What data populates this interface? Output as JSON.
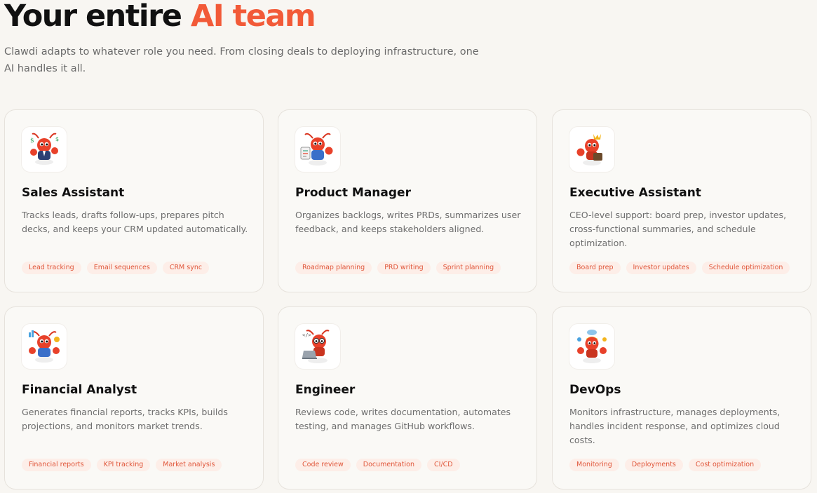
{
  "hero": {
    "title_prefix": "Your entire ",
    "title_accent": "AI team",
    "subtitle": "Clawdi adapts to whatever role you need. From closing deals to deploying infrastructure, one AI handles it all."
  },
  "colors": {
    "accent": "#f25a38",
    "tag_text": "#e0563a",
    "tag_bg": "#fdeee8",
    "card_bg": "#faf9f6",
    "page_bg": "#f8f6f2"
  },
  "cards": [
    {
      "icon": "lobster-sales-icon",
      "title": "Sales Assistant",
      "description": "Tracks leads, drafts follow-ups, prepares pitch decks, and keeps your CRM updated automatically.",
      "tags": [
        "Lead tracking",
        "Email sequences",
        "CRM sync"
      ]
    },
    {
      "icon": "lobster-product-icon",
      "title": "Product Manager",
      "description": "Organizes backlogs, writes PRDs, summarizes user feedback, and keeps stakeholders aligned.",
      "tags": [
        "Roadmap planning",
        "PRD writing",
        "Sprint planning"
      ]
    },
    {
      "icon": "lobster-executive-icon",
      "title": "Executive Assistant",
      "description": "CEO-level support: board prep, investor updates, cross-functional summaries, and schedule optimization.",
      "tags": [
        "Board prep",
        "Investor updates",
        "Schedule optimization"
      ]
    },
    {
      "icon": "lobster-finance-icon",
      "title": "Financial Analyst",
      "description": "Generates financial reports, tracks KPIs, builds projections, and monitors market trends.",
      "tags": [
        "Financial reports",
        "KPI tracking",
        "Market analysis"
      ]
    },
    {
      "icon": "lobster-engineer-icon",
      "title": "Engineer",
      "description": "Reviews code, writes documentation, automates testing, and manages GitHub workflows.",
      "tags": [
        "Code review",
        "Documentation",
        "CI/CD"
      ]
    },
    {
      "icon": "lobster-devops-icon",
      "title": "DevOps",
      "description": "Monitors infrastructure, manages deployments, handles incident response, and optimizes cloud costs.",
      "tags": [
        "Monitoring",
        "Deployments",
        "Cost optimization"
      ]
    }
  ]
}
